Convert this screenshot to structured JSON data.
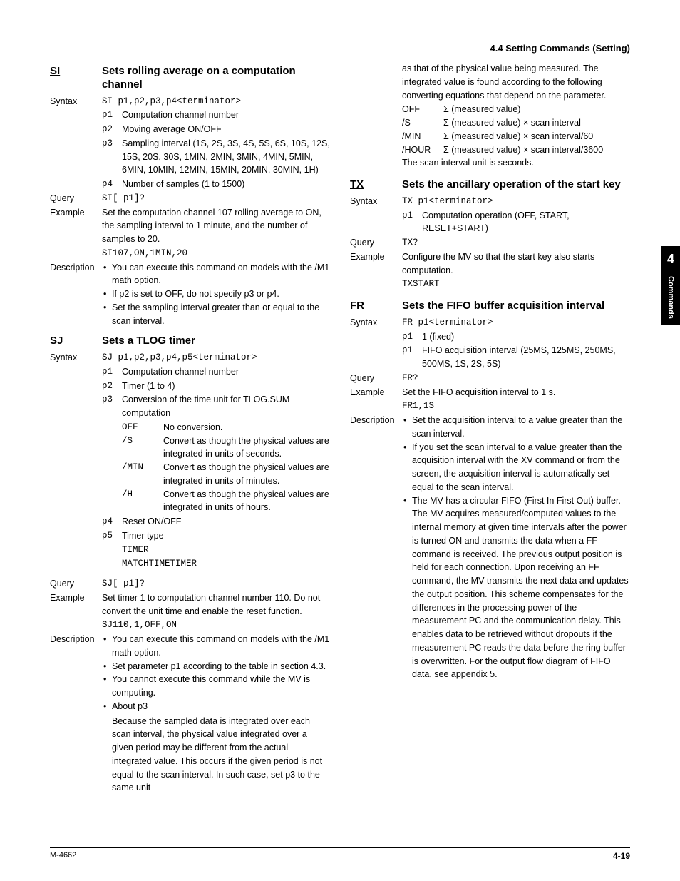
{
  "header": "4.4  Setting Commands (Setting)",
  "sidebar": {
    "num": "4",
    "label": "Commands"
  },
  "footer": {
    "left": "M-4662",
    "right": "4-19"
  },
  "si": {
    "code": "SI",
    "title": "Sets rolling average on a computation channel",
    "syntax": "SI p1,p2,p3,p4<terminator>",
    "p1": "Computation channel number",
    "p2": "Moving average ON/OFF",
    "p3": "Sampling interval (1S, 2S, 3S, 4S, 5S, 6S, 10S, 12S, 15S, 20S, 30S, 1MIN, 2MIN, 3MIN, 4MIN, 5MIN, 6MIN, 10MIN, 12MIN, 15MIN, 20MIN, 30MIN, 1H)",
    "p4": "Number of samples (1 to 1500)",
    "query": "SI[ p1]?",
    "example": "Set the computation channel 107 rolling average to ON, the sampling interval to 1 minute, and the number of samples to 20.",
    "example_code": "SI107,ON,1MIN,20",
    "desc": [
      "You can execute this command on models with the /M1 math option.",
      "If p2 is set to OFF, do not specify p3 or p4.",
      "Set the sampling interval greater than or equal to the scan interval."
    ]
  },
  "sj": {
    "code": "SJ",
    "title": "Sets a TLOG timer",
    "syntax": "SJ p1,p2,p3,p4,p5<terminator>",
    "p1": "Computation channel number",
    "p2": "Timer (1 to 4)",
    "p3": "Conversion of the time unit for TLOG.SUM computation",
    "p3_off": "No conversion.",
    "p3_s": "Convert as though the physical values are integrated in units of seconds.",
    "p3_min": "Convert as though the physical values are integrated in units of minutes.",
    "p3_h": "Convert as though the physical values are integrated in units of hours.",
    "p4": "Reset ON/OFF",
    "p5": "Timer type",
    "p5_a": "TIMER",
    "p5_b": "MATCHTIMETIMER",
    "query": "SJ[ p1]?",
    "example": "Set timer 1 to computation channel number 110. Do not convert the unit time and enable the reset function.",
    "example_code": "SJ110,1,OFF,ON",
    "desc1": "You can execute this command on models with the /M1 math option.",
    "desc2": "Set parameter p1 according to the table in section 4.3.",
    "desc3": "You cannot execute this command while the MV is computing.",
    "desc4": "About p3",
    "desc4_body": "Because the sampled data is integrated over each scan interval, the physical value integrated over a given period may be different from the actual integrated value. This occurs if the given period is not equal to the scan interval. In such case, set p3 to the same unit",
    "cont": "as that of the physical value being measured. The integrated value is found according to the following converting equations that depend on the parameter.",
    "t_off": "Σ (measured value)",
    "t_s": "Σ (measured value) × scan interval",
    "t_min": "Σ (measured value) × scan interval/60",
    "t_hour": "Σ (measured value) × scan interval/3600",
    "t_note": "The scan interval unit is seconds."
  },
  "tx": {
    "code": "TX",
    "title": "Sets the ancillary operation of the start key",
    "syntax": "TX p1<terminator>",
    "p1": "Computation operation (OFF, START, RESET+START)",
    "query": "TX?",
    "example": "Configure the MV so that the start key also starts computation.",
    "example_code": "TXSTART"
  },
  "fr": {
    "code": "FR",
    "title": "Sets the FIFO buffer acquisition interval",
    "syntax": "FR p1<terminator>",
    "p1a": "1 (fixed)",
    "p1b": "FIFO acquisition interval (25MS, 125MS, 250MS, 500MS, 1S, 2S, 5S)",
    "query": "FR?",
    "example": "Set the FIFO acquisition interval to 1 s.",
    "example_code": "FR1,1S",
    "desc1": "Set the acquisition interval to a value greater than the scan interval.",
    "desc2": "If you set the scan interval to a value greater than the acquisition interval with the XV command or from the screen, the acquisition interval is automatically set equal to the scan interval.",
    "desc3": "The MV has a circular FIFO (First In First Out) buffer. The MV acquires measured/computed values to the internal memory at given time intervals after the power is turned ON and transmits the data when a FF command is received. The previous output position is held for each connection. Upon receiving an FF command, the MV transmits the next data and updates the output position. This scheme compensates for the differences in the processing power of the measurement PC and the communication delay. This enables data to be retrieved without dropouts if the measurement PC reads the data before the ring buffer is overwritten. For the output flow diagram of FIFO data, see appendix 5."
  },
  "labels": {
    "syntax": "Syntax",
    "query": "Query",
    "example": "Example",
    "description": "Description",
    "p1": "p1",
    "p2": "p2",
    "p3": "p3",
    "p4": "p4",
    "p5": "p5",
    "off": "OFF",
    "s": "/S",
    "min": "/MIN",
    "h": "/H",
    "hour": "/HOUR"
  }
}
